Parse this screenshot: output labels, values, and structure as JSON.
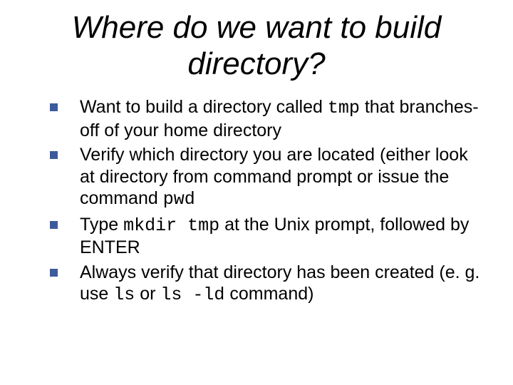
{
  "title": "Where do we want to build directory?",
  "bullets": [
    {
      "pre": "Want to build a directory called ",
      "code1": "tmp",
      "post1": " that branches-off of your home directory"
    },
    {
      "pre": "Verify which directory you are located (either look at directory from command prompt or issue the command ",
      "code1": "pwd"
    },
    {
      "pre": "Type ",
      "code1": "mkdir tmp",
      "post1": " at the Unix prompt, followed by ENTER"
    },
    {
      "pre": "Always verify that directory has been created (e. g.  use ",
      "code1": "ls",
      "post1": " or ",
      "code2": "ls -ld",
      "post2": " command)"
    }
  ]
}
